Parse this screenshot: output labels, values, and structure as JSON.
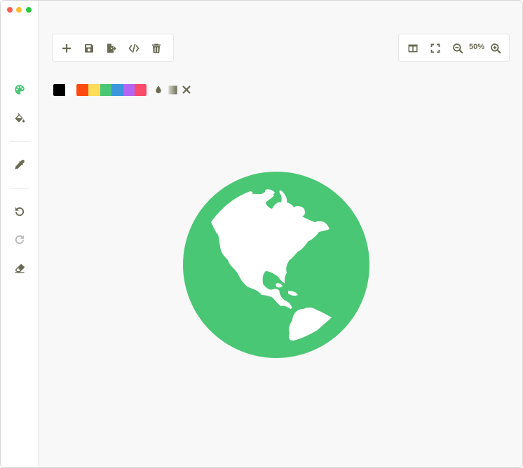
{
  "window": {
    "controls": [
      "close",
      "minimize",
      "maximize"
    ]
  },
  "sidebar": {
    "tools": [
      {
        "name": "palette-icon",
        "active": true,
        "color": "#4ac775"
      },
      {
        "name": "fill-bucket-icon",
        "active": false
      },
      {
        "name": "eyedropper-icon",
        "active": false
      },
      {
        "name": "undo-icon",
        "active": false
      },
      {
        "name": "redo-icon",
        "active": false,
        "disabled": true
      },
      {
        "name": "eraser-icon",
        "active": false
      }
    ]
  },
  "toolbar": {
    "left_actions": [
      "plus-icon",
      "save-icon",
      "export-icon",
      "code-icon",
      "trash-icon"
    ],
    "right_actions": [
      "split-view-icon",
      "fullscreen-icon",
      "zoom-out-icon",
      "zoom-in-icon"
    ],
    "zoom_level": "50%"
  },
  "palette": {
    "colors": [
      "#000000",
      "#ffffff",
      "#ff4b12",
      "#ffdc5a",
      "#4ac775",
      "#3b96de",
      "#b466f2",
      "#f84c6a"
    ],
    "extra_tools": [
      "opacity-icon",
      "gradient-icon",
      "clear-icon"
    ]
  },
  "canvas": {
    "image": "globe-americas-icon",
    "fill_color": "#4ac775"
  },
  "theme": {
    "icon_color": "#6b6b55",
    "accent": "#4ac775"
  }
}
